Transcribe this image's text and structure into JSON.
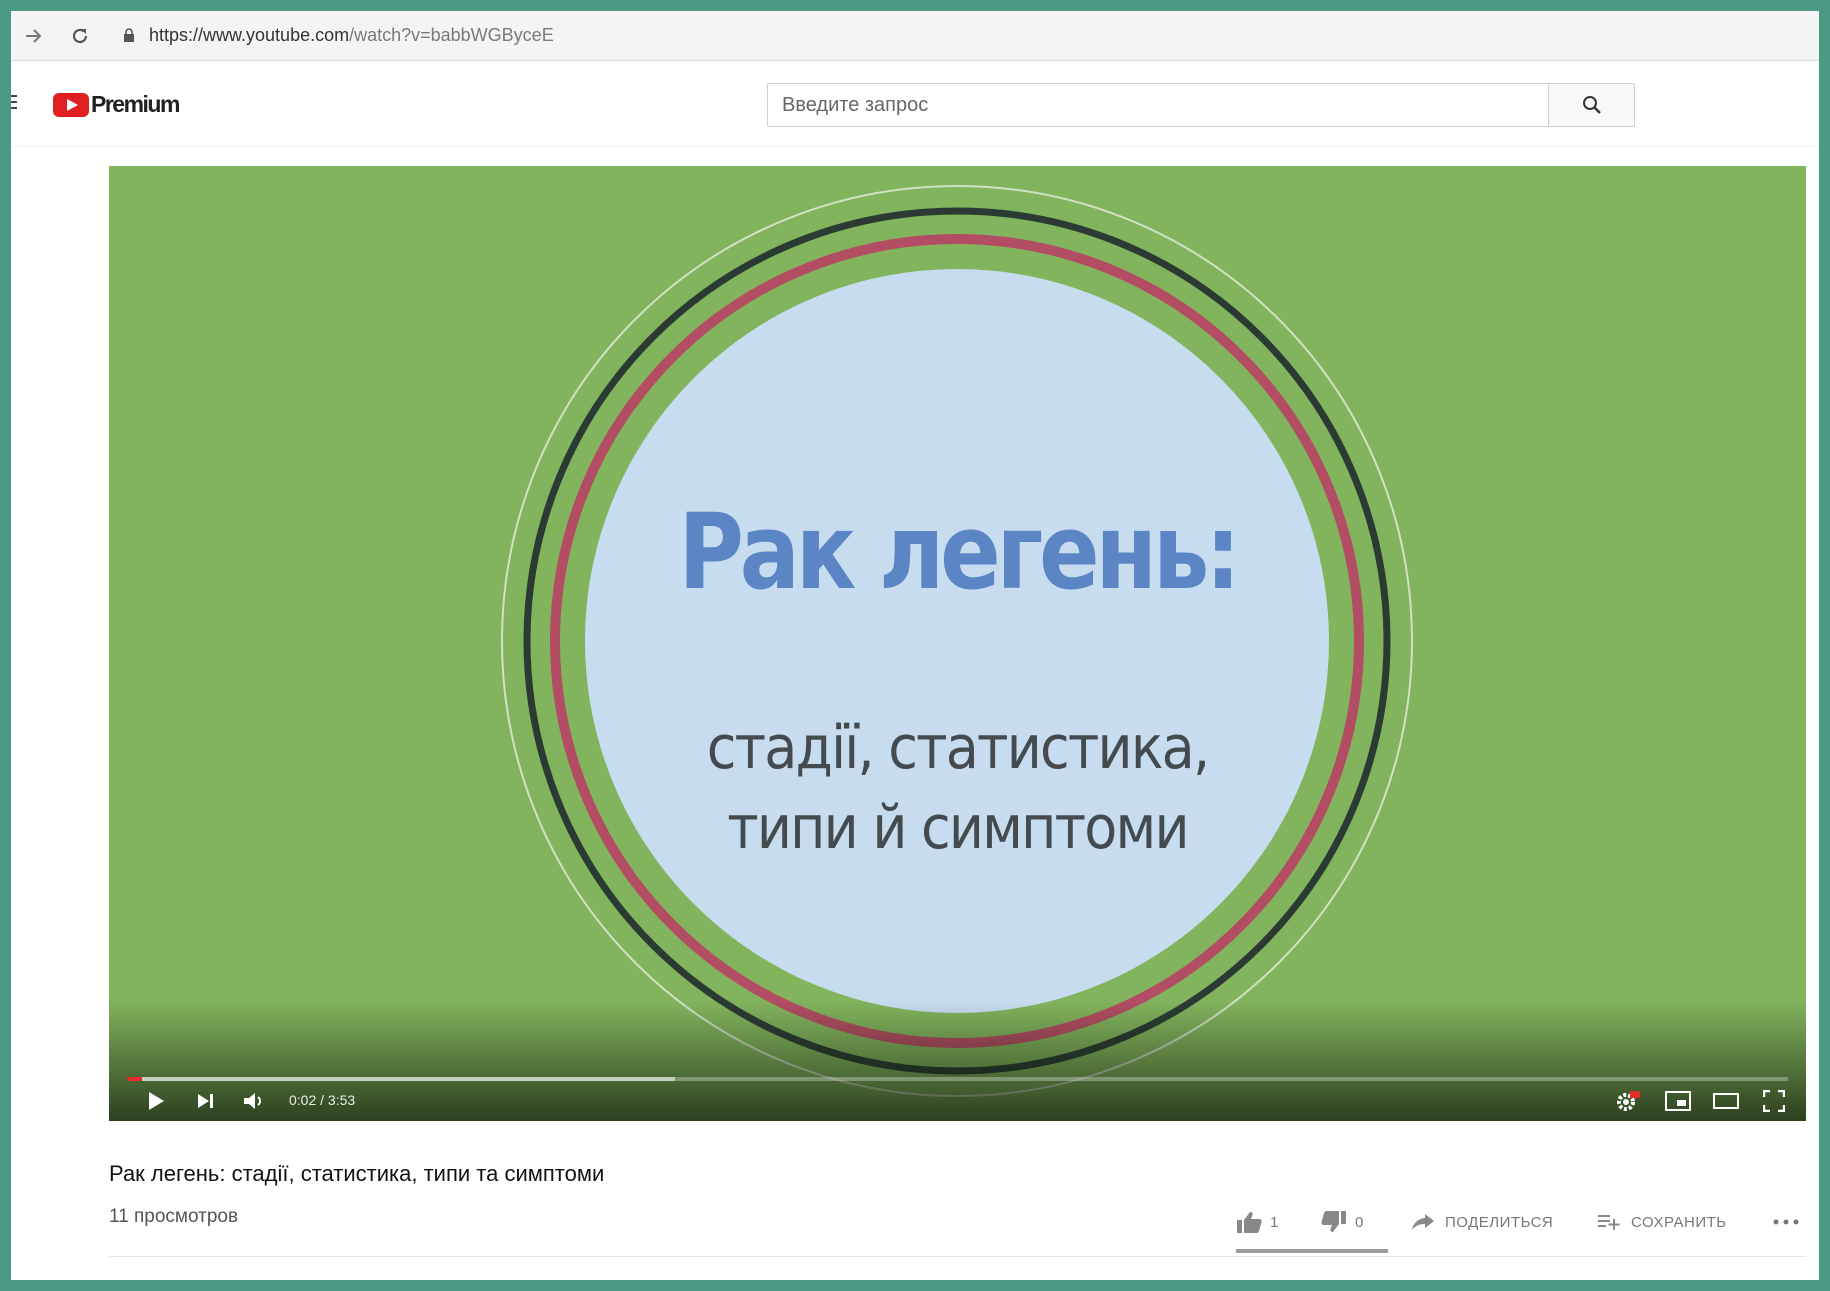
{
  "browser": {
    "url_host": "https://www.youtube.com",
    "url_path": "/watch?v=babbWGBycеE"
  },
  "header": {
    "logo_text": "Premium",
    "search_placeholder": "Введите запрос"
  },
  "player": {
    "title_line": "Рак легень:",
    "subtitle_line1": "стадії, статистика,",
    "subtitle_line2": "типи й симптоми",
    "current_time": "0:02",
    "duration": "3:53",
    "time_display": "0:02 / 3:53",
    "played_fraction": 0.009,
    "buffered_fraction": 0.33,
    "colors": {
      "background": "#82b35d",
      "center_circle": "#c7ddef",
      "title": "#5c85c6",
      "inner_ring": "#b34d63",
      "outer_ring": "#2b3b34",
      "progress": "#e52d27"
    }
  },
  "video": {
    "title": "Рак легень: стадії, статистика, типи та симптоми",
    "views": "11 просмотров",
    "likes": "1",
    "dislikes": "0",
    "share_label": "ПОДЕЛИТЬСЯ",
    "save_label": "СОХРАНИТЬ"
  },
  "icons": [
    "forward-icon",
    "reload-icon",
    "lock-icon",
    "menu-icon",
    "youtube-logo-icon",
    "search-icon",
    "play-icon",
    "next-icon",
    "volume-icon",
    "settings-icon",
    "miniplayer-icon",
    "theater-icon",
    "fullscreen-icon",
    "thumbs-up-icon",
    "thumbs-down-icon",
    "share-icon",
    "playlist-add-icon",
    "more-icon"
  ]
}
